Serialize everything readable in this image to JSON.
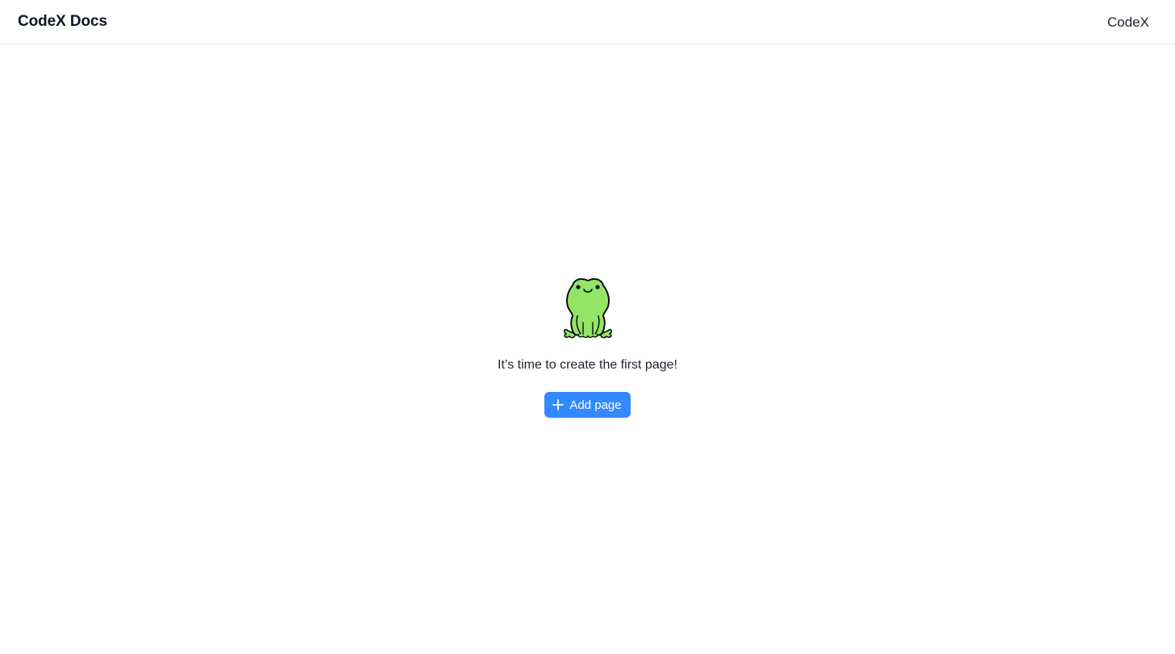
{
  "header": {
    "brand": "CodeX Docs",
    "menu_link": "CodeX"
  },
  "empty_state": {
    "illustration": "frog-icon",
    "message": "It’s time to create the first page!",
    "button_label": "Add page",
    "button_icon": "plus-icon"
  },
  "colors": {
    "accent": "#3389ff",
    "frog_green": "#92e567",
    "text": "#1d2330",
    "border": "#e8e8eb"
  }
}
